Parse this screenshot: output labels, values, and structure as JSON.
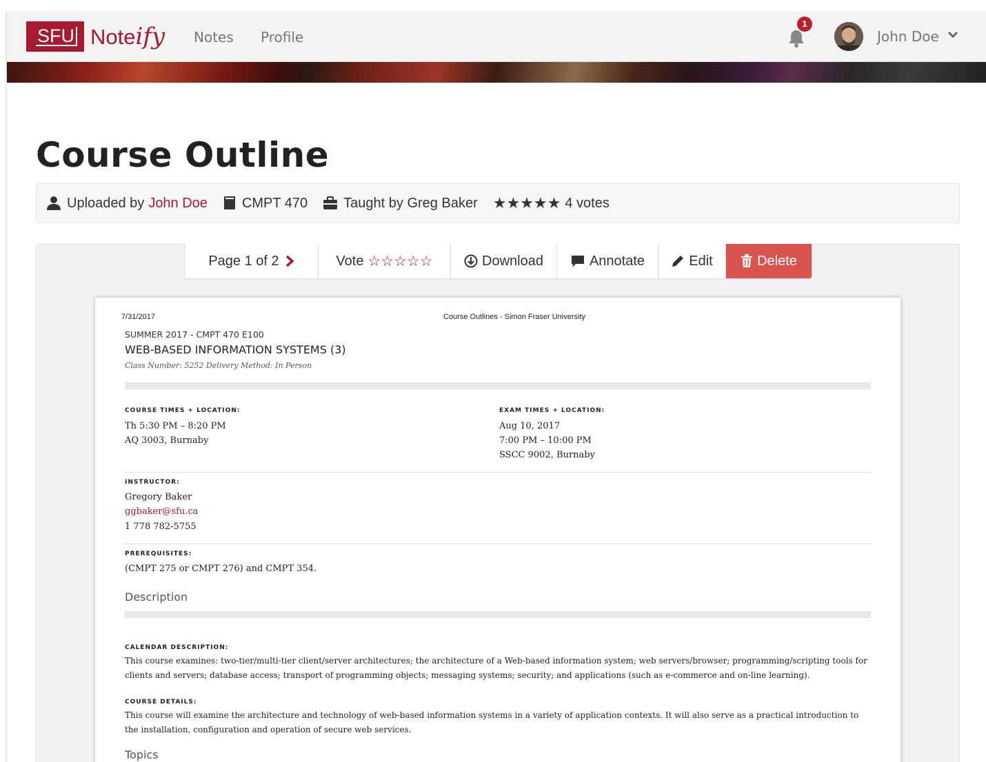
{
  "nav": {
    "brand_sfu": "SFU",
    "brand_name": "Note",
    "brand_script": "ify",
    "links": [
      "Notes",
      "Profile"
    ],
    "notification_count": "1",
    "user_name": "John Doe"
  },
  "page": {
    "title": "Course Outline"
  },
  "meta": {
    "uploaded_prefix": "Uploaded by",
    "uploader": "John Doe",
    "course": "CMPT 470",
    "taught_by": "Taught by Greg Baker",
    "rating_stars": "★★★★★",
    "votes": "4 votes"
  },
  "toolbar": {
    "page_label": "Page 1 of 2",
    "vote_label": "Vote",
    "vote_stars": "☆☆☆☆☆",
    "download_label": "Download",
    "annotate_label": "Annotate",
    "edit_label": "Edit",
    "delete_label": "Delete"
  },
  "document": {
    "header_date": "7/31/2017",
    "header_title": "Course Outlines - Simon Fraser University",
    "term": "SUMMER 2017 - CMPT 470 E100",
    "course_name": "WEB-BASED INFORMATION SYSTEMS (3)",
    "class_info": "Class Number: 5252    Delivery Method: In Person",
    "course_times_label": "COURSE TIMES + LOCATION:",
    "course_times_line1": "Th 5:30 PM – 8:20 PM",
    "course_times_line2": "AQ 3003, Burnaby",
    "exam_times_label": "EXAM TIMES + LOCATION:",
    "exam_line1": "Aug 10, 2017",
    "exam_line2": "7:00 PM – 10:00 PM",
    "exam_line3": "SSCC 9002, Burnaby",
    "instructor_label": "INSTRUCTOR:",
    "instructor_name": "Gregory Baker",
    "instructor_email": "ggbaker@sfu.ca",
    "instructor_phone": "1 778 782-5755",
    "prereq_label": "PREREQUISITES:",
    "prereq_text": "(CMPT 275 or CMPT 276) and CMPT 354.",
    "description_heading": "Description",
    "calendar_label": "CALENDAR DESCRIPTION:",
    "calendar_text": "This course examines: two-tier/multi-tier client/server architectures; the architecture of a Web-based information system; web servers/browser; programming/scripting tools for clients and servers; database access; transport of programming objects; messaging systems; security; and applications (such as e-commerce and on-line learning).",
    "details_label": "COURSE DETAILS:",
    "details_text": "This course will examine the architecture and technology of web-based information systems in a variety of application contexts. It will also serve as a practical introduction to the installation, configuration and operation of secure web services.",
    "topics_heading": "Topics"
  },
  "colors": {
    "brand": "#a6192e",
    "delete": "#d9534f"
  }
}
